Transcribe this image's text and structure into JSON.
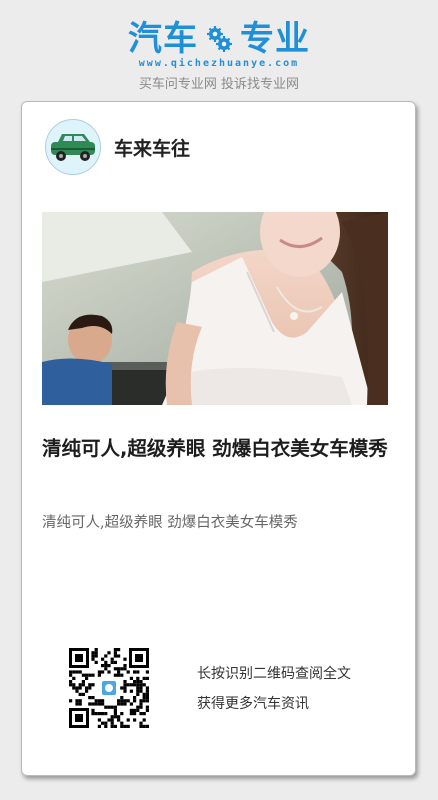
{
  "brand": {
    "logo_left": "汽车",
    "logo_right": "专业",
    "logo_icon": "gear-icon",
    "url": "www.qichezhuanye.com",
    "slogan": "买车问专业网 投诉找专业网",
    "accent_color": "#1f8fd8"
  },
  "card": {
    "author": {
      "name": "车来车往",
      "avatar_icon": "car-icon"
    },
    "hero_image": {
      "description_icon": "photo-image"
    },
    "title": "清纯可人,超级养眼  劲爆白衣美女车模秀",
    "summary": "清纯可人,超级养眼  劲爆白衣美女车模秀",
    "qr": {
      "icon": "qr-code-icon",
      "line1": "长按识别二维码查阅全文",
      "line2": "获得更多汽车资讯"
    }
  }
}
